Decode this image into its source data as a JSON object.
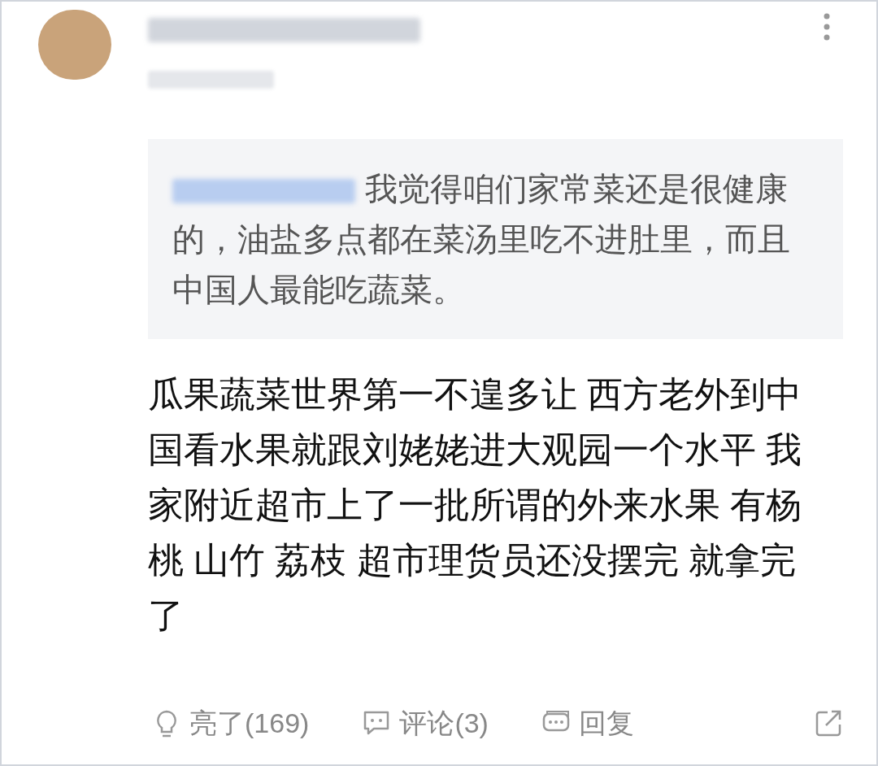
{
  "post": {
    "quote": {
      "text": "我觉得咱们家常菜还是很健康的，油盐多点都在菜汤里吃不进肚里，而且中国人最能吃蔬菜。"
    },
    "body": "瓜果蔬菜世界第一不遑多让 西方老外到中国看水果就跟刘姥姥进大观园一个水平 我家附近超市上了一批所谓的外来水果 有杨桃 山竹 荔枝 超市理货员还没摆完 就拿完了",
    "actions": [
      {
        "kind": "like",
        "label": "亮了(169)"
      },
      {
        "kind": "comment",
        "label": "评论(3)"
      },
      {
        "kind": "reply",
        "label": "回复"
      },
      {
        "kind": "share"
      }
    ]
  }
}
